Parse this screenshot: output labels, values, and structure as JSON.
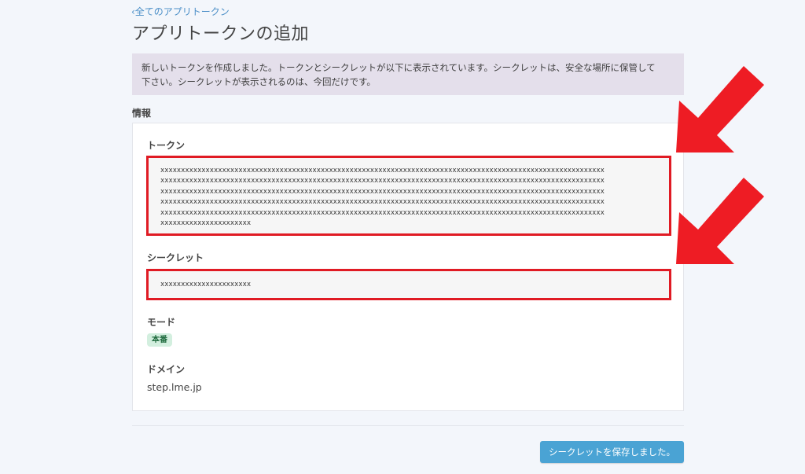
{
  "header": {
    "back_link": "‹全てのアプリトークン",
    "title": "アプリトークンの追加"
  },
  "alert": {
    "line1": "新しいトークンを作成しました。トークンとシークレットが以下に表示されています。シークレットは、安全な場所に保管して",
    "line2": "下さい。シークレットが表示されるのは、今回だけです。"
  },
  "info": {
    "section_label": "情報",
    "token_label": "トークン",
    "token_lines": [
      "xxxxxxxxxxxxxxxxxxxxxxxxxxxxxxxxxxxxxxxxxxxxxxxxxxxxxxxxxxxxxxxxxxxxxxxxxxxxxxxxxxxxxxxxxxxxxxxxxxxxxxxxxxxx",
      "xxxxxxxxxxxxxxxxxxxxxxxxxxxxxxxxxxxxxxxxxxxxxxxxxxxxxxxxxxxxxxxxxxxxxxxxxxxxxxxxxxxxxxxxxxxxxxxxxxxxxxxxxxxx",
      "xxxxxxxxxxxxxxxxxxxxxxxxxxxxxxxxxxxxxxxxxxxxxxxxxxxxxxxxxxxxxxxxxxxxxxxxxxxxxxxxxxxxxxxxxxxxxxxxxxxxxxxxxxxx",
      "xxxxxxxxxxxxxxxxxxxxxxxxxxxxxxxxxxxxxxxxxxxxxxxxxxxxxxxxxxxxxxxxxxxxxxxxxxxxxxxxxxxxxxxxxxxxxxxxxxxxxxxxxxxx",
      "xxxxxxxxxxxxxxxxxxxxxxxxxxxxxxxxxxxxxxxxxxxxxxxxxxxxxxxxxxxxxxxxxxxxxxxxxxxxxxxxxxxxxxxxxxxxxxxxxxxxxxxxxxxx",
      "xxxxxxxxxxxxxxxxxxxxxx"
    ],
    "secret_label": "シークレット",
    "secret_value": "xxxxxxxxxxxxxxxxxxxxxx",
    "mode_label": "モード",
    "mode_badge": "本番",
    "domain_label": "ドメイン",
    "domain_value": "step.lme.jp"
  },
  "actions": {
    "save_label": "シークレットを保存しました。"
  },
  "colors": {
    "link": "#4a8ec7",
    "alert_bg": "#e4dfeb",
    "highlight_border": "#e01b24",
    "annotation_arrow": "#ee1c24",
    "badge_bg": "#d3efdf",
    "badge_text": "#1f6b3e",
    "button_bg": "#4aa3d4"
  },
  "icons": {
    "annotation": "arrow-pointing-down-left-icon"
  }
}
